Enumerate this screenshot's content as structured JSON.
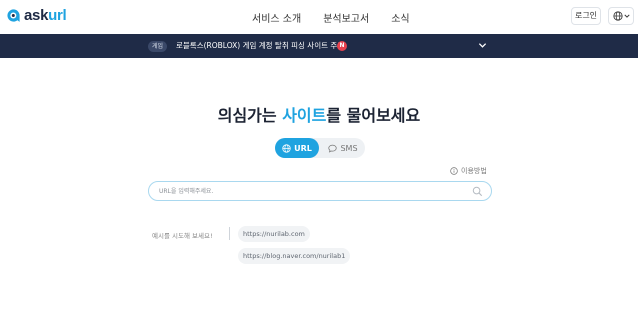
{
  "header": {
    "logo_text_a": "ask",
    "logo_text_b": "url",
    "nav": [
      "서비스 소개",
      "분석보고서",
      "소식"
    ],
    "login_label": "로그인"
  },
  "notice": {
    "tag": "게임",
    "text": "로블록스(ROBLOX) 게임 계정 탈취 피싱 사이트 주의",
    "badge": "N"
  },
  "main": {
    "headline_before": "의심가는 ",
    "headline_highlight": "사이트",
    "headline_after": "를 물어보세요",
    "toggle": {
      "url_label": "URL",
      "sms_label": "SMS",
      "active": "URL"
    },
    "howto_label": "이용방법",
    "search_placeholder": "URL을 입력해주세요.",
    "examples_label": "예시를 시도해 보세요!",
    "examples": [
      "https://nurilab.com",
      "https://blog.naver.com/nurilab1"
    ]
  },
  "colors": {
    "accent": "#1fa3e0",
    "notice_bg": "#1f2b47",
    "badge": "#e8424f"
  },
  "icons": [
    "askurl-logo-icon",
    "globe-icon",
    "chevron-down-icon",
    "chat-bubble-icon",
    "info-icon",
    "search-icon"
  ]
}
